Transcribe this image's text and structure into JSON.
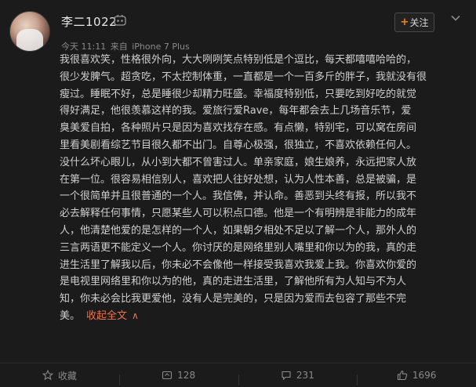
{
  "post": {
    "username": "李二1022",
    "follow_label": "关注",
    "follow_plus": "+",
    "meta": {
      "time": "今天 11:11",
      "source_prefix": "来自",
      "device": "iPhone 7 Plus"
    },
    "lines": [
      "我很喜欢笑，性格很外向，大大咧咧笑点特别低是个逗比，每天都嘻嘻哈哈的，",
      "很少发脾气。超贪吃，不太控制体重，一直都是一个一百多斤的胖子，我就没有很",
      "瘦过。睡眠不好，总是睡很少却精力旺盛。幸福度特别低，只要吃到好吃的就觉",
      "得好满足，他很羡慕这样的我。爱旅行爱Rave，每年都会去上几场音乐节，爱",
      "臭美爱自拍，各种照片只是因为喜欢找存在感。有点懒，特别宅，可以窝在房间",
      "里看美剧看综艺节目很久都不出门。自尊心极强，很独立，不喜欢依赖任何人。",
      "没什么坏心眼儿，从小到大都不曾害过人。单亲家庭，娘生娘养，永远把家人放",
      "在第一位。很容易相信别人，喜欢把人往好处想，认为人性本善，总是被骗，是",
      "一个很简单并且很普通的一个人。我信佛，并认命。善恶到头终有报，所以我不",
      "必去解释任何事情，只愿某些人可以积点口德。他是一个有明辨是非能力的成年",
      "人，他清楚他爱的是怎样的一个人，如果朝夕相处不足以了解一个人，那外人的",
      "三言两语更不能定义一个人。你讨厌的是网络里别人嘴里和你以为的我，真的走",
      "进生活里了解我以后，你未必不会像他一样接受我喜欢我爱上我。你喜欢你爱的",
      "是电视里网络里和你以为的他，真的走进生活里，了解他所有为人知与不为人",
      "知，你未必会比我更爱他，没有人是完美的，只是因为爱而去包容了那些不完",
      "美。"
    ],
    "collapse_label": "收起全文",
    "collapse_icon": "∧"
  },
  "actions": {
    "favorite_label": "收藏",
    "repost_count": "128",
    "comment_count": "231",
    "like_count": "1696"
  },
  "colors": {
    "background": "#1b1b1b",
    "text": "#cfcfcf",
    "muted": "#8a8a8a",
    "link": "#eb7350",
    "accent": "#ff8200"
  }
}
